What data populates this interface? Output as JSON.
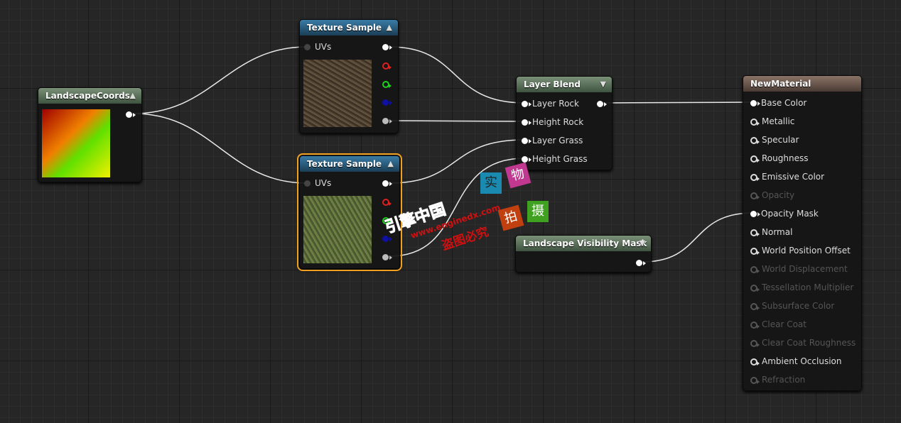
{
  "nodes": {
    "landscape_coords": {
      "title": "LandscapeCoords"
    },
    "texture_sample_1": {
      "title": "Texture Sample",
      "input": "UVs"
    },
    "texture_sample_2": {
      "title": "Texture Sample",
      "input": "UVs"
    },
    "layer_blend": {
      "title": "Layer Blend",
      "inputs": [
        "Layer Rock",
        "Height Rock",
        "Layer Grass",
        "Height Grass"
      ]
    },
    "visibility_mask": {
      "title": "Landscape Visibility Mask"
    },
    "new_material": {
      "title": "NewMaterial",
      "inputs": [
        {
          "label": "Base Color",
          "enabled": true
        },
        {
          "label": "Metallic",
          "enabled": true
        },
        {
          "label": "Specular",
          "enabled": true
        },
        {
          "label": "Roughness",
          "enabled": true
        },
        {
          "label": "Emissive Color",
          "enabled": true
        },
        {
          "label": "Opacity",
          "enabled": false
        },
        {
          "label": "Opacity Mask",
          "enabled": true
        },
        {
          "label": "Normal",
          "enabled": true
        },
        {
          "label": "World Position Offset",
          "enabled": true
        },
        {
          "label": "World Displacement",
          "enabled": false
        },
        {
          "label": "Tessellation Multiplier",
          "enabled": false
        },
        {
          "label": "Subsurface Color",
          "enabled": false
        },
        {
          "label": "Clear Coat",
          "enabled": false
        },
        {
          "label": "Clear Coat Roughness",
          "enabled": false
        },
        {
          "label": "Ambient Occlusion",
          "enabled": true
        },
        {
          "label": "Refraction",
          "enabled": false
        }
      ]
    }
  },
  "colors": {
    "selection": "#f0a020",
    "wire": "#e8e8e8",
    "red_pin": "#e02020",
    "green_pin": "#20d020",
    "blue_pin": "#1010a0"
  },
  "watermark": {
    "brand": "引擎中国",
    "url": "www.enginedx.com",
    "notice": "盗图必究",
    "chars": [
      "实",
      "物",
      "拍",
      "摄"
    ]
  }
}
